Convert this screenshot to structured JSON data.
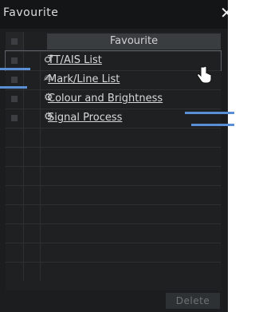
{
  "window": {
    "title": "Favourite",
    "close_glyph": "✕"
  },
  "table": {
    "header_label": "Favourite",
    "rows": [
      {
        "icon": "tt-ais-icon",
        "glyph": "♂",
        "label": "TT/AIS List",
        "selected": true
      },
      {
        "icon": "mark-line-icon",
        "glyph": "✍",
        "label": "Mark/Line List",
        "selected": false
      },
      {
        "icon": "gear-icon",
        "glyph": "⚙",
        "label": "Colour and Brightness",
        "selected": false
      },
      {
        "icon": "gear-icon",
        "glyph": "⚙",
        "label": "Signal Process",
        "selected": false
      }
    ]
  },
  "footer": {
    "delete_label": "Delete"
  },
  "colors": {
    "panel_bg": "#1b1d1e",
    "pointer_line": "#5a8fd6",
    "header_bg": "#3a3d3f"
  }
}
